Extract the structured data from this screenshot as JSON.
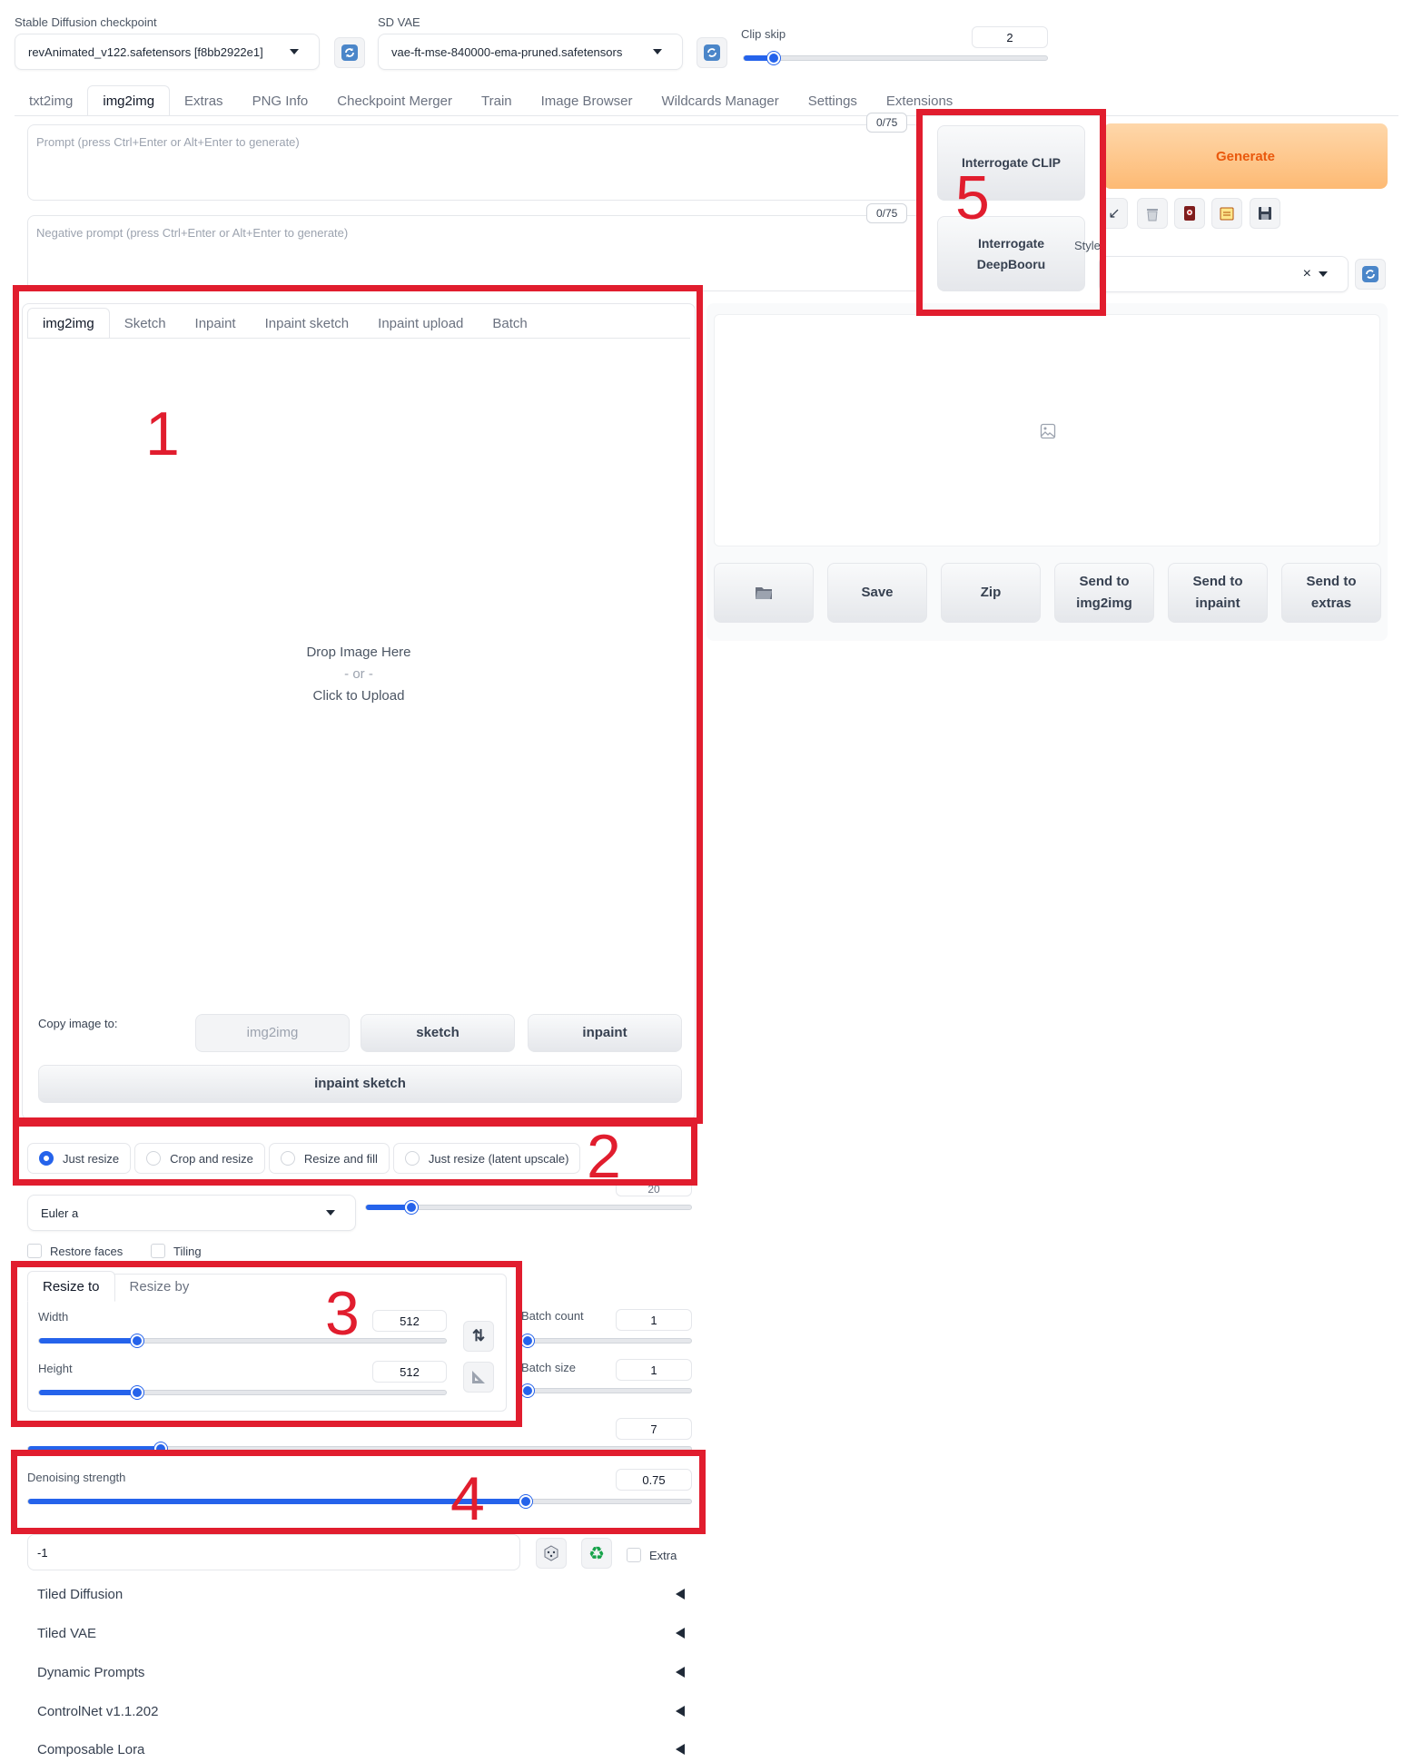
{
  "header": {
    "checkpoint_label": "Stable Diffusion checkpoint",
    "checkpoint_value": "revAnimated_v122.safetensors [f8bb2922e1]",
    "vae_label": "SD VAE",
    "vae_value": "vae-ft-mse-840000-ema-pruned.safetensors",
    "clip_skip_label": "Clip skip",
    "clip_skip_value": "2",
    "clip_skip_fraction": 0.1
  },
  "main_tabs": [
    "txt2img",
    "img2img",
    "Extras",
    "PNG Info",
    "Checkpoint Merger",
    "Train",
    "Image Browser",
    "Wildcards Manager",
    "Settings",
    "Extensions"
  ],
  "prompt": {
    "placeholder": "Prompt (press Ctrl+Enter or Alt+Enter to generate)",
    "counter": "0/75",
    "neg_placeholder": "Negative prompt (press Ctrl+Enter or Alt+Enter to generate)",
    "neg_counter": "0/75"
  },
  "interrogate": {
    "clip": "Interrogate CLIP",
    "deepbooru_line1": "Interrogate",
    "deepbooru_line2": "DeepBooru"
  },
  "generate_label": "Generate",
  "styles_label": "Styles",
  "styles_clear": "×",
  "image_tabs": [
    "img2img",
    "Sketch",
    "Inpaint",
    "Inpaint sketch",
    "Inpaint upload",
    "Batch"
  ],
  "drop": {
    "line1": "Drop Image Here",
    "line2": "- or -",
    "line3": "Click to Upload"
  },
  "copy": {
    "label": "Copy image to:",
    "img2img": "img2img",
    "sketch": "sketch",
    "inpaint": "inpaint",
    "inpaint_sketch": "inpaint sketch"
  },
  "output_buttons": {
    "save": "Save",
    "zip": "Zip",
    "send_img2img_1": "Send to",
    "send_img2img_2": "img2img",
    "send_inpaint_1": "Send to",
    "send_inpaint_2": "inpaint",
    "send_extras_1": "Send to",
    "send_extras_2": "extras"
  },
  "resize_modes": [
    "Just resize",
    "Crop and resize",
    "Resize and fill",
    "Just resize (latent upscale)"
  ],
  "sampler": {
    "value": "Euler a",
    "steps_value": "20",
    "steps_fraction": 0.14
  },
  "checks": {
    "restore_faces": "Restore faces",
    "tiling": "Tiling"
  },
  "resize_tabs": [
    "Resize to",
    "Resize by"
  ],
  "dims": {
    "width_label": "Width",
    "width_value": "512",
    "width_fraction": 0.24,
    "height_label": "Height",
    "height_value": "512",
    "height_fraction": 0.24
  },
  "batch": {
    "count_label": "Batch count",
    "count_value": "1",
    "size_label": "Batch size",
    "size_value": "1"
  },
  "cfg": {
    "value": "7",
    "fraction": 0.2
  },
  "denoise": {
    "label": "Denoising strength",
    "value": "0.75",
    "fraction": 0.75
  },
  "seed": {
    "value": "-1",
    "extra": "Extra"
  },
  "accordions": [
    "Tiled Diffusion",
    "Tiled VAE",
    "Dynamic Prompts",
    "ControlNet v1.1.202",
    "Composable Lora"
  ],
  "annotations": [
    "1",
    "2",
    "3",
    "4",
    "5"
  ],
  "colors": {
    "accent": "#2563eb",
    "annotation_red": "#e11d2e",
    "generate_bg": "#fdba74",
    "generate_text": "#ea580c"
  }
}
